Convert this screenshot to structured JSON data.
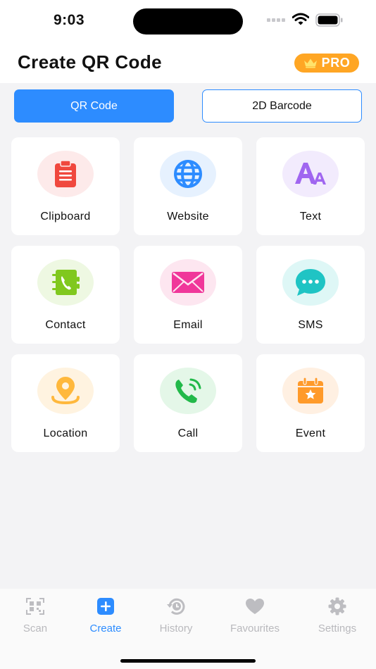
{
  "status_bar": {
    "time": "9:03"
  },
  "header": {
    "title": "Create QR Code",
    "pro_label": "PRO"
  },
  "segments": {
    "qr_code": "QR Code",
    "barcode": "2D Barcode"
  },
  "grid": {
    "items": [
      {
        "label": "Clipboard",
        "icon": "clipboard-icon",
        "color": "#f0483e",
        "bg": "#fdeaea"
      },
      {
        "label": "Website",
        "icon": "globe-icon",
        "color": "#2d8cff",
        "bg": "#e6f1fe"
      },
      {
        "label": "Text",
        "icon": "text-icon",
        "color": "#a066f0",
        "bg": "#f2ebfd"
      },
      {
        "label": "Contact",
        "icon": "contact-book-icon",
        "color": "#80c81e",
        "bg": "#eef8e2"
      },
      {
        "label": "Email",
        "icon": "envelope-icon",
        "color": "#f0379a",
        "bg": "#fde6f0"
      },
      {
        "label": "SMS",
        "icon": "chat-bubble-icon",
        "color": "#1fc4c4",
        "bg": "#def7f6"
      },
      {
        "label": "Location",
        "icon": "location-pin-icon",
        "color": "#ffb83c",
        "bg": "#fff3e0"
      },
      {
        "label": "Call",
        "icon": "phone-icon",
        "color": "#22b94a",
        "bg": "#e4f7e8"
      },
      {
        "label": "Event",
        "icon": "calendar-icon",
        "color": "#ff9a2a",
        "bg": "#fff0e2"
      }
    ]
  },
  "tab_bar": {
    "tabs": [
      {
        "label": "Scan",
        "icon": "qr-scan-icon"
      },
      {
        "label": "Create",
        "icon": "plus-square-icon"
      },
      {
        "label": "History",
        "icon": "history-icon"
      },
      {
        "label": "Favourites",
        "icon": "heart-icon"
      },
      {
        "label": "Settings",
        "icon": "gear-icon"
      }
    ],
    "active": "Create"
  },
  "colors": {
    "accent": "#2d8cff",
    "pro_badge": "#ffa624",
    "tab_inactive": "#b9b9bd",
    "background": "#f3f3f5"
  }
}
